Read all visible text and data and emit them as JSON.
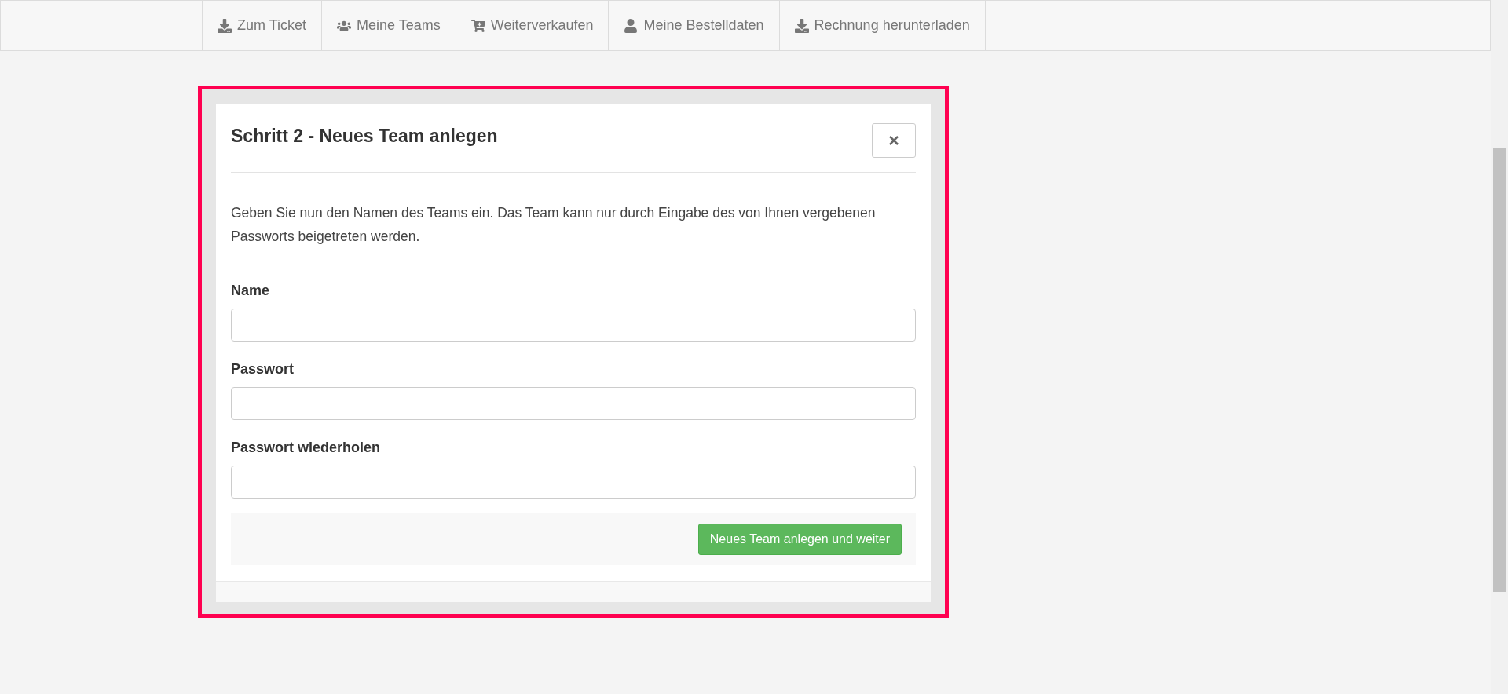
{
  "nav": [
    {
      "kind": "ticket",
      "label": "Zum Ticket"
    },
    {
      "kind": "teams",
      "label": "Meine Teams"
    },
    {
      "kind": "resell",
      "label": "Weiterverkaufen"
    },
    {
      "kind": "orders",
      "label": "Meine Bestelldaten"
    },
    {
      "kind": "invoice",
      "label": "Rechnung herunterladen"
    }
  ],
  "dialog": {
    "title": "Schritt 2 - Neues Team anlegen",
    "close": "×",
    "intro": "Geben Sie nun den Namen des Teams ein. Das Team kann nur durch Eingabe des von Ihnen vergebenen Passworts beigetreten werden.",
    "fields": [
      {
        "label": "Name"
      },
      {
        "label": "Passwort"
      },
      {
        "label": "Passwort wiederholen"
      }
    ],
    "submit": "Neues Team anlegen und weiter"
  }
}
